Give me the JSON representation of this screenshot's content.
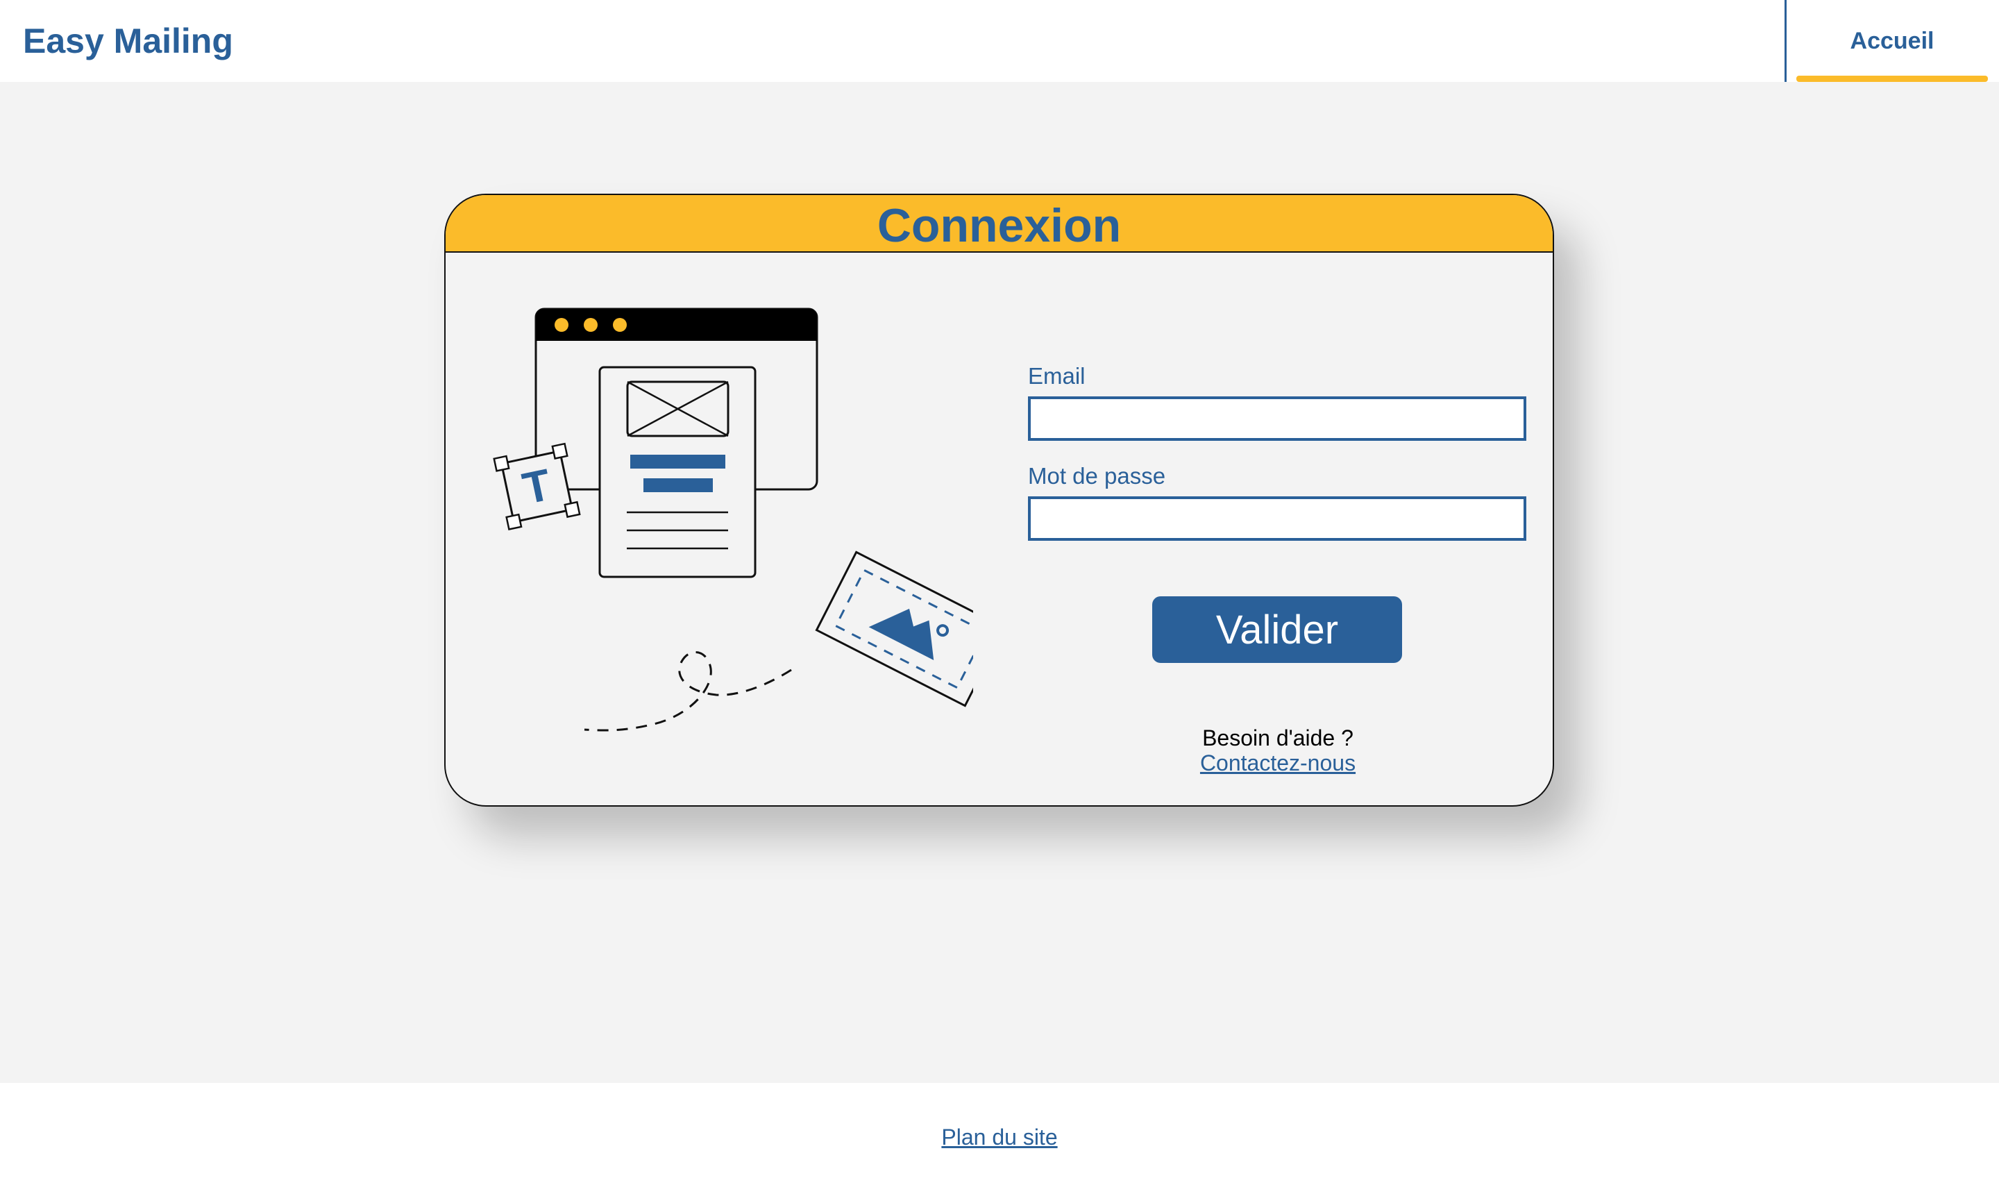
{
  "header": {
    "brand": "Easy Mailing",
    "nav": [
      {
        "label": "Accueil",
        "active": true
      }
    ]
  },
  "login": {
    "title": "Connexion",
    "email_label": "Email",
    "email_value": "",
    "password_label": "Mot de passe",
    "password_value": "",
    "submit_label": "Valider",
    "help_text": "Besoin d'aide ?",
    "contact_link": "Contactez-nous"
  },
  "illustration": {
    "glyph": "T",
    "icons": [
      "browser-window-icon",
      "email-template-icon",
      "text-tool-icon",
      "image-card-icon",
      "dashed-path"
    ]
  },
  "footer": {
    "sitemap_link": "Plan du site"
  },
  "colors": {
    "primary": "#2a6099",
    "accent": "#fbbb2a",
    "background": "#f3f3f3",
    "surface": "#ffffff"
  }
}
